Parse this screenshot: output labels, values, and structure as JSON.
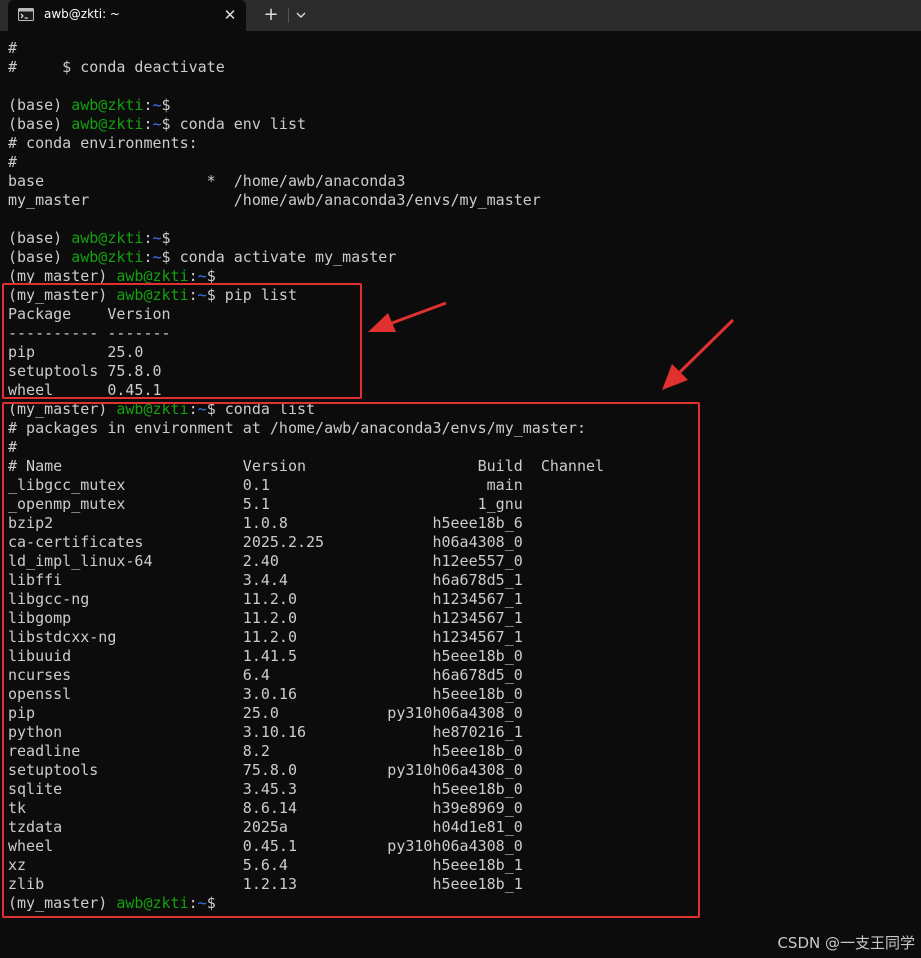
{
  "window": {
    "tab_title": "awb@zkti: ~",
    "close_symbol": "✕",
    "new_tab_symbol": "+"
  },
  "terminal": {
    "lines": [
      [
        {
          "t": "#"
        }
      ],
      [
        {
          "t": "#     $ conda deactivate"
        }
      ],
      [
        {
          "t": ""
        }
      ],
      [
        {
          "t": "(base) "
        },
        {
          "t": "awb@zkti",
          "c": "user"
        },
        {
          "t": ":"
        },
        {
          "t": "~",
          "c": "path"
        },
        {
          "t": "$"
        }
      ],
      [
        {
          "t": "(base) "
        },
        {
          "t": "awb@zkti",
          "c": "user"
        },
        {
          "t": ":"
        },
        {
          "t": "~",
          "c": "path"
        },
        {
          "t": "$ conda env list"
        }
      ],
      [
        {
          "t": "# conda environments:"
        }
      ],
      [
        {
          "t": "#"
        }
      ],
      [
        {
          "t": "base                  *  /home/awb/anaconda3"
        }
      ],
      [
        {
          "t": "my_master                /home/awb/anaconda3/envs/my_master"
        }
      ],
      [
        {
          "t": ""
        }
      ],
      [
        {
          "t": "(base) "
        },
        {
          "t": "awb@zkti",
          "c": "user"
        },
        {
          "t": ":"
        },
        {
          "t": "~",
          "c": "path"
        },
        {
          "t": "$"
        }
      ],
      [
        {
          "t": "(base) "
        },
        {
          "t": "awb@zkti",
          "c": "user"
        },
        {
          "t": ":"
        },
        {
          "t": "~",
          "c": "path"
        },
        {
          "t": "$ conda activate my_master"
        }
      ],
      [
        {
          "t": "(my_master) "
        },
        {
          "t": "awb@zkti",
          "c": "user"
        },
        {
          "t": ":"
        },
        {
          "t": "~",
          "c": "path"
        },
        {
          "t": "$"
        }
      ],
      [
        {
          "t": "(my_master) "
        },
        {
          "t": "awb@zkti",
          "c": "user"
        },
        {
          "t": ":"
        },
        {
          "t": "~",
          "c": "path"
        },
        {
          "t": "$ pip list"
        }
      ],
      [
        {
          "t": "Package    Version"
        }
      ],
      [
        {
          "t": "---------- -------"
        }
      ],
      [
        {
          "t": "pip        25.0"
        }
      ],
      [
        {
          "t": "setuptools 75.8.0"
        }
      ],
      [
        {
          "t": "wheel      0.45.1"
        }
      ],
      [
        {
          "t": "(my_master) "
        },
        {
          "t": "awb@zkti",
          "c": "user"
        },
        {
          "t": ":"
        },
        {
          "t": "~",
          "c": "path"
        },
        {
          "t": "$ conda list"
        }
      ],
      [
        {
          "t": "# packages in environment at /home/awb/anaconda3/envs/my_master:"
        }
      ],
      [
        {
          "t": "#"
        }
      ],
      [
        {
          "t": "# Name                    Version                   Build  Channel"
        }
      ],
      [
        {
          "t": "_libgcc_mutex             0.1                        main"
        }
      ],
      [
        {
          "t": "_openmp_mutex             5.1                       1_gnu"
        }
      ],
      [
        {
          "t": "bzip2                     1.0.8                h5eee18b_6"
        }
      ],
      [
        {
          "t": "ca-certificates           2025.2.25            h06a4308_0"
        }
      ],
      [
        {
          "t": "ld_impl_linux-64          2.40                 h12ee557_0"
        }
      ],
      [
        {
          "t": "libffi                    3.4.4                h6a678d5_1"
        }
      ],
      [
        {
          "t": "libgcc-ng                 11.2.0               h1234567_1"
        }
      ],
      [
        {
          "t": "libgomp                   11.2.0               h1234567_1"
        }
      ],
      [
        {
          "t": "libstdcxx-ng              11.2.0               h1234567_1"
        }
      ],
      [
        {
          "t": "libuuid                   1.41.5               h5eee18b_0"
        }
      ],
      [
        {
          "t": "ncurses                   6.4                  h6a678d5_0"
        }
      ],
      [
        {
          "t": "openssl                   3.0.16               h5eee18b_0"
        }
      ],
      [
        {
          "t": "pip                       25.0            py310h06a4308_0"
        }
      ],
      [
        {
          "t": "python                    3.10.16              he870216_1"
        }
      ],
      [
        {
          "t": "readline                  8.2                  h5eee18b_0"
        }
      ],
      [
        {
          "t": "setuptools                75.8.0          py310h06a4308_0"
        }
      ],
      [
        {
          "t": "sqlite                    3.45.3               h5eee18b_0"
        }
      ],
      [
        {
          "t": "tk                        8.6.14               h39e8969_0"
        }
      ],
      [
        {
          "t": "tzdata                    2025a                h04d1e81_0"
        }
      ],
      [
        {
          "t": "wheel                     0.45.1          py310h06a4308_0"
        }
      ],
      [
        {
          "t": "xz                        5.6.4                h5eee18b_1"
        }
      ],
      [
        {
          "t": "zlib                      1.2.13               h5eee18b_1"
        }
      ],
      [
        {
          "t": "(my_master) "
        },
        {
          "t": "awb@zkti",
          "c": "user"
        },
        {
          "t": ":"
        },
        {
          "t": "~",
          "c": "path"
        },
        {
          "t": "$"
        }
      ]
    ]
  },
  "watermark": "CSDN @一支王同学",
  "colors": {
    "background": "#0c0c0c",
    "text": "#cccccc",
    "user": "#13a10e",
    "path": "#3b78ff",
    "annotation": "#e03030"
  }
}
